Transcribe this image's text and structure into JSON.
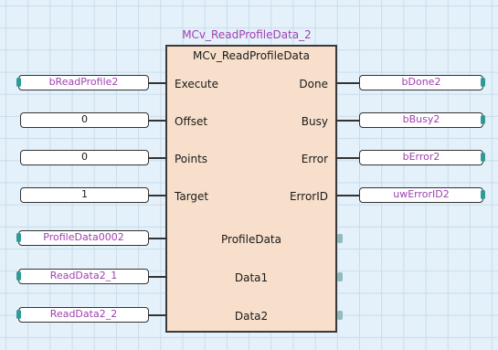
{
  "fb": {
    "instance_name": "MCv_ReadProfileData_2",
    "type_name": "MCv_ReadProfileData"
  },
  "inputs": [
    {
      "pin": "Execute",
      "variable": "bReadProfile2",
      "kind": "label"
    },
    {
      "pin": "Offset",
      "variable": "0",
      "kind": "constant"
    },
    {
      "pin": "Points",
      "variable": "0",
      "kind": "constant"
    },
    {
      "pin": "Target",
      "variable": "1",
      "kind": "constant"
    }
  ],
  "outputs": [
    {
      "pin": "Done",
      "variable": "bDone2"
    },
    {
      "pin": "Busy",
      "variable": "bBusy2"
    },
    {
      "pin": "Error",
      "variable": "bError2"
    },
    {
      "pin": "ErrorID",
      "variable": "uwErrorID2"
    }
  ],
  "inouts": [
    {
      "pin": "ProfileData",
      "variable": "ProfileData0002"
    },
    {
      "pin": "Data1",
      "variable": "ReadData2_1"
    },
    {
      "pin": "Data2",
      "variable": "ReadData2_2"
    }
  ],
  "colors": {
    "background": "#e4f1fa",
    "grid": "#c9dcea",
    "block_fill": "#f7dfcb",
    "label_text": "#a040b0",
    "connector": "#2f9a96"
  }
}
